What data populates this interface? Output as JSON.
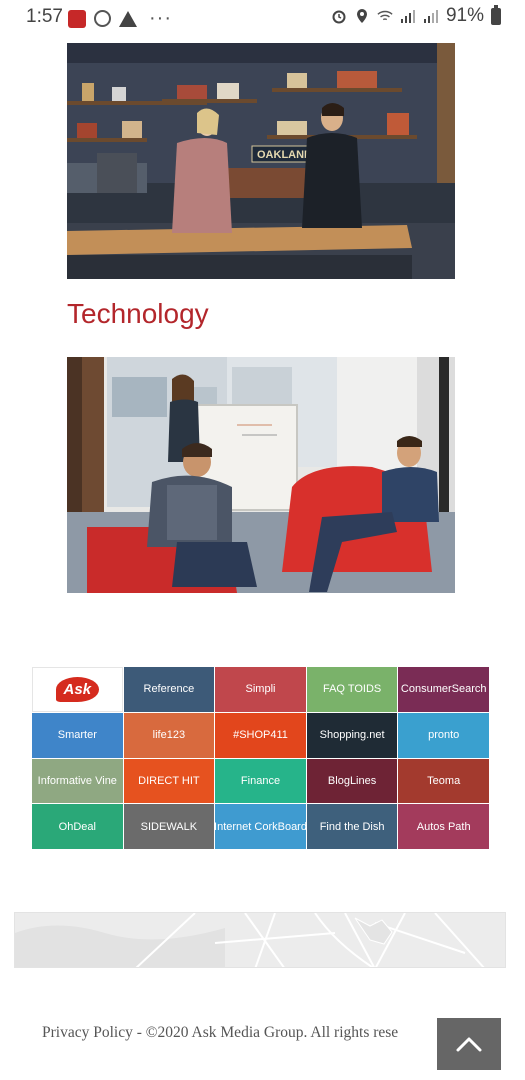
{
  "status_bar": {
    "time": "1:57",
    "battery": "91%",
    "more": "···"
  },
  "section": {
    "title": "Technology"
  },
  "brands": [
    {
      "label": "Ask",
      "bg": "#ffffff"
    },
    {
      "label": "Reference",
      "bg": "#3d5a78"
    },
    {
      "label": "Simpli",
      "bg": "#c0474c"
    },
    {
      "label": "FAQ TOIDS",
      "bg": "#7ab26a"
    },
    {
      "label": "ConsumerSearch",
      "bg": "#7a2c55"
    },
    {
      "label": "Smarter",
      "bg": "#3f85c9"
    },
    {
      "label": "life123",
      "bg": "#d86a3e"
    },
    {
      "label": "#SHOP411",
      "bg": "#e2461c"
    },
    {
      "label": "Shopping.net",
      "bg": "#1f2b35"
    },
    {
      "label": "pronto",
      "bg": "#3aa0cf"
    },
    {
      "label": "Informative Vine",
      "bg": "#8fa882"
    },
    {
      "label": "DIRECT HIT",
      "bg": "#e6521f"
    },
    {
      "label": "Finance",
      "bg": "#26b48a"
    },
    {
      "label": "BlogLines",
      "bg": "#6e2335"
    },
    {
      "label": "Teoma",
      "bg": "#a33a2e"
    },
    {
      "label": "OhDeal",
      "bg": "#2aa878"
    },
    {
      "label": "SIDEWALK",
      "bg": "#6b6b6b"
    },
    {
      "label": "Internet CorkBoard",
      "bg": "#3f9bd0"
    },
    {
      "label": "Find the Dish",
      "bg": "#3e607c"
    },
    {
      "label": "Autos Path",
      "bg": "#a33b5c"
    }
  ],
  "footer": {
    "privacy_link": "Privacy Policy",
    "copyright": " - ©2020 Ask Media Group. All rights rese"
  }
}
